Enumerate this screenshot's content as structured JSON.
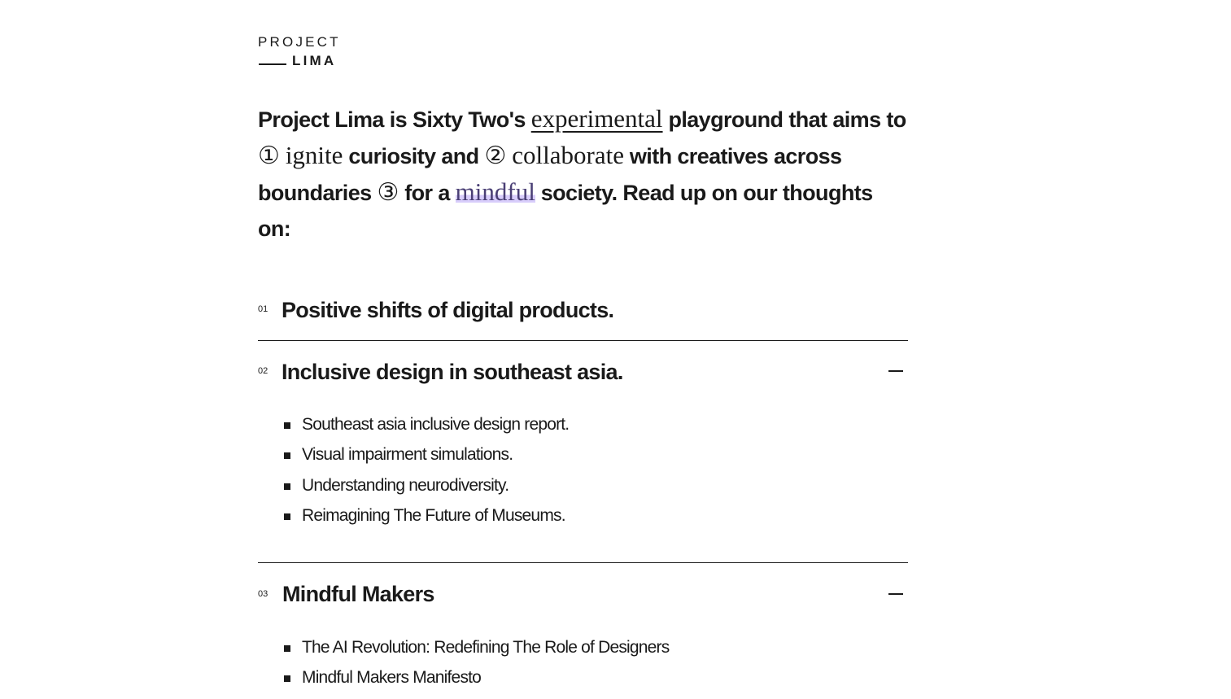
{
  "logo": {
    "top": "PROJECT",
    "bottom": "LIMA"
  },
  "intro": {
    "p1": "Project Lima is Sixty Two's ",
    "w1": "experimental",
    "p2": " playground that aims to ",
    "n1": "①",
    "w2": "ignite",
    "p3": " curiosity and ",
    "n2": "②",
    "w3": "collaborate",
    "p4": " with creatives across boundaries ",
    "n3": "③",
    "p5": " for a ",
    "w4": "mindful",
    "p6": " society. Read up on our thoughts on:"
  },
  "sections": [
    {
      "num": "01",
      "title": "Positive shifts of digital products.",
      "expanded": false,
      "items": []
    },
    {
      "num": "02",
      "title": "Inclusive design in southeast asia.",
      "expanded": true,
      "items": [
        "Southeast asia inclusive design report.",
        "Visual impairment simulations.",
        "Understanding neurodiversity.",
        "Reimagining The Future of Museums."
      ]
    },
    {
      "num": "03",
      "title": "Mindful Makers",
      "expanded": true,
      "items": [
        "The AI Revolution: Redefining The Role of Designers",
        "Mindful Makers Manifesto"
      ]
    }
  ],
  "colors": {
    "text": "#1a1a1a",
    "highlight": "#d8cdfb",
    "highlight_text": "#4a3f75",
    "background": "#ffffff"
  }
}
